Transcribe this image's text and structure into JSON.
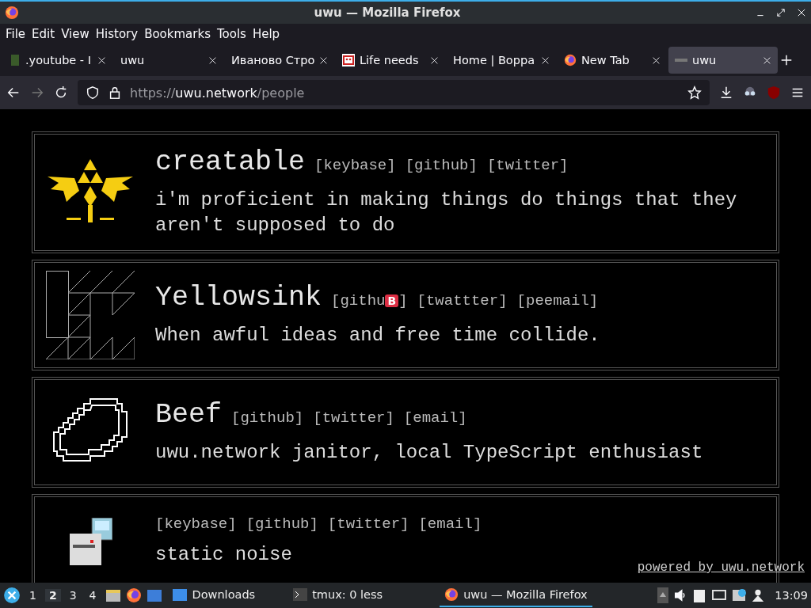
{
  "window": {
    "title": "uwu — Mozilla Firefox"
  },
  "menu": [
    "File",
    "Edit",
    "View",
    "History",
    "Bookmarks",
    "Tools",
    "Help"
  ],
  "tabs": [
    {
      "label": ".youtube - I",
      "selected": false
    },
    {
      "label": "uwu",
      "selected": false
    },
    {
      "label": "Иваново Стро",
      "selected": false
    },
    {
      "label": "Life needs",
      "selected": false
    },
    {
      "label": "Home | Bорpa",
      "selected": false
    },
    {
      "label": "New Tab",
      "selected": false
    },
    {
      "label": "uwu",
      "selected": true
    }
  ],
  "address": {
    "scheme": "https://",
    "host": "uwu.network",
    "path": "/people"
  },
  "people": [
    {
      "name": "creatable",
      "links": [
        {
          "text": "[keybase]"
        },
        {
          "text": "[github]"
        },
        {
          "text": "[twitter]"
        }
      ],
      "bio": "i'm proficient in making things do things that they aren't supposed to do"
    },
    {
      "name": "Yellowsink",
      "links": [
        {
          "text": "[githu",
          "badge": "B",
          "after": "]"
        },
        {
          "text": "[twattter]"
        },
        {
          "text": "[peemail]"
        }
      ],
      "bio": "When awful ideas and free time collide."
    },
    {
      "name": "Beef",
      "links": [
        {
          "text": "[github]"
        },
        {
          "text": "[twitter]"
        },
        {
          "text": "[email]"
        }
      ],
      "bio": "uwu.network janitor, local TypeScript enthusiast"
    },
    {
      "links": [
        {
          "text": "[keybase]"
        },
        {
          "text": "[github]"
        },
        {
          "text": "[twitter]"
        },
        {
          "text": "[email]"
        }
      ],
      "bio": "static noise"
    }
  ],
  "footer": "powered by uwu.network",
  "taskbar": {
    "workspaces": [
      {
        "label": "1",
        "selected": false
      },
      {
        "label": "2",
        "selected": true
      },
      {
        "label": "3",
        "selected": false
      },
      {
        "label": "4",
        "selected": false
      }
    ],
    "tasks": [
      {
        "label": "Downloads",
        "selected": false
      },
      {
        "label": "tmux: 0 less",
        "selected": false
      },
      {
        "label": "uwu — Mozilla Firefox",
        "selected": true
      }
    ],
    "clock": "13:09"
  }
}
